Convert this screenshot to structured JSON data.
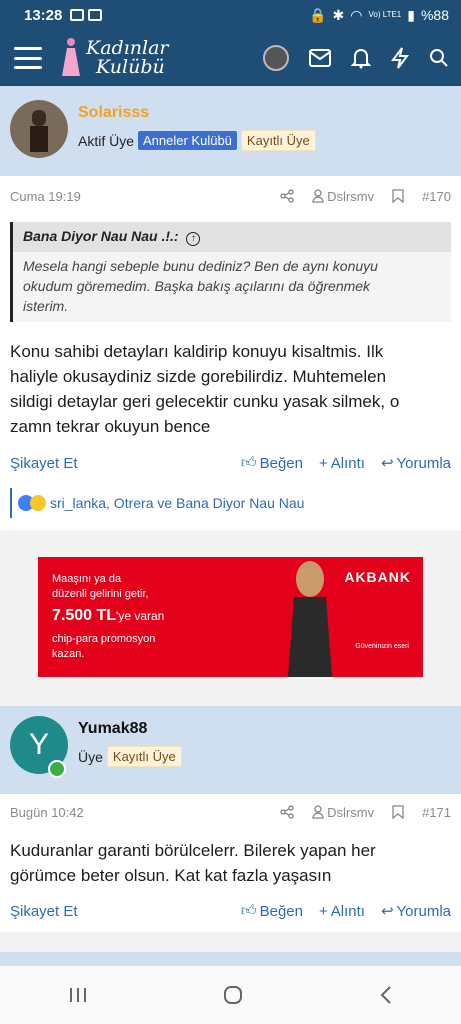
{
  "status_bar": {
    "time": "13:28",
    "network": "Vo) LTE1",
    "battery": "%88"
  },
  "app": {
    "logo_line1": "Kadınlar",
    "logo_line2": "Kulübü",
    "icons": [
      "menu-icon",
      "avatar",
      "mail-icon",
      "bell-icon",
      "lightning-icon",
      "search-icon"
    ]
  },
  "post1": {
    "username": "Solarisss",
    "role": "Aktif Üye",
    "badge_blue": "Anneler Kulübü",
    "badge_reg": "Kayıtlı Üye",
    "date": "Cuma 19:19",
    "author_tag": "Dslrsmv",
    "number": "#170",
    "quote_author": "Bana Diyor Nau Nau .!.:",
    "quote_lines": [
      "Mesela hangi sebeple bunu dediniz? Ben de aynı konuyu",
      "okudum göremedim. Başka bakış açılarını da öğrenmek",
      "isterim."
    ],
    "text_lines": [
      "Konu sahibi detayları kaldirip konuyu kisaltmis. Ilk",
      "haliyle okusaydiniz sizde gorebilirdiz. Muhtemelen",
      "sildigi detaylar geri gelecektir cunku yasak silmek, o",
      "zamn tekrar okuyun bence"
    ],
    "report": "Şikayet Et",
    "like": "Beğen",
    "quote_action": "Alıntı",
    "reply": "Yorumla",
    "reactions_text": "sri_lanka, Otrera ve Bana Diyor Nau Nau"
  },
  "ad": {
    "lines": [
      "Maaşını ya da",
      "düzenli gelirini getir,"
    ],
    "amount": "7.500 TL",
    "amount_suffix": "'ye varan",
    "lines2": [
      "chip-para promosyon",
      "kazan."
    ],
    "brand": "AKBANK",
    "tagline": "Güveninizin eseri"
  },
  "post2": {
    "avatar_letter": "Y",
    "username": "Yumak88",
    "role": "Üye",
    "badge_reg": "Kayıtlı Üye",
    "date": "Bugün 10:42",
    "author_tag": "Dslrsmv",
    "number": "#171",
    "text_lines": [
      "Kuduranlar garanti börülcelerr. Bilerek yapan her",
      "görümce beter olsun. Kat kat fazla yaşasın"
    ],
    "report": "Şikayet Et",
    "like": "Beğen",
    "quote_action": "Alıntı",
    "reply": "Yorumla"
  },
  "colors": {
    "header_bg": "#1e4e75",
    "username_orange": "#f5a020",
    "link_blue": "#2d6bb5",
    "avatar_teal": "#1f8a8a",
    "ad_red": "#e3001b"
  }
}
